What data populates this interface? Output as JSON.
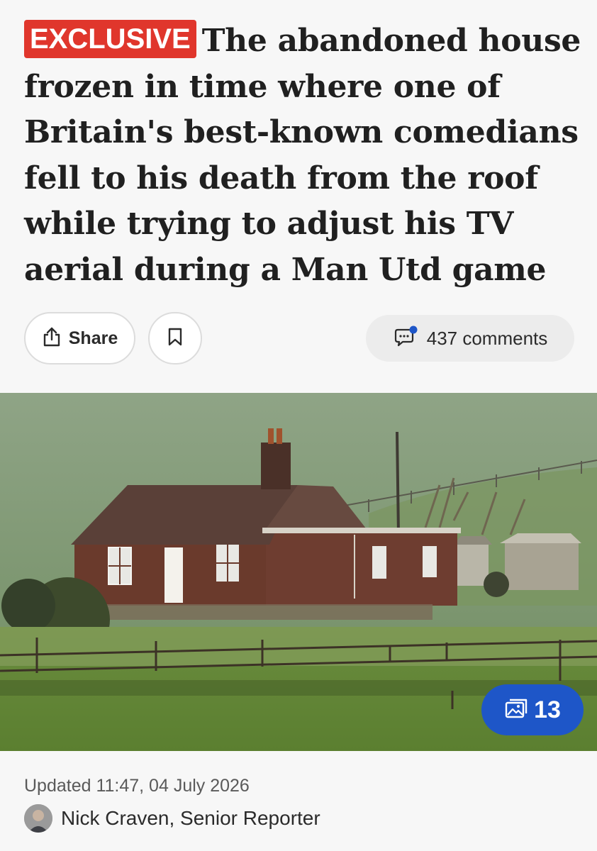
{
  "headline": {
    "badge": "EXCLUSIVE",
    "text": "The abandoned house frozen in time where one of Britain's best-known comedians fell to his death from the roof while trying to adjust his TV aerial during a Man Utd game"
  },
  "actions": {
    "share_label": "Share",
    "comments_label": "437 comments"
  },
  "gallery": {
    "count": "13"
  },
  "meta": {
    "updated": "Updated 11:47, 04 July 2026",
    "author": "Nick Craven, Senior Reporter"
  },
  "colors": {
    "badge": "#e0362c",
    "gallery": "#1e56c8",
    "notification_dot": "#1e56c8"
  },
  "icons": {
    "share": "share-icon",
    "bookmark": "bookmark-icon",
    "comments": "comments-icon",
    "gallery": "gallery-icon"
  }
}
